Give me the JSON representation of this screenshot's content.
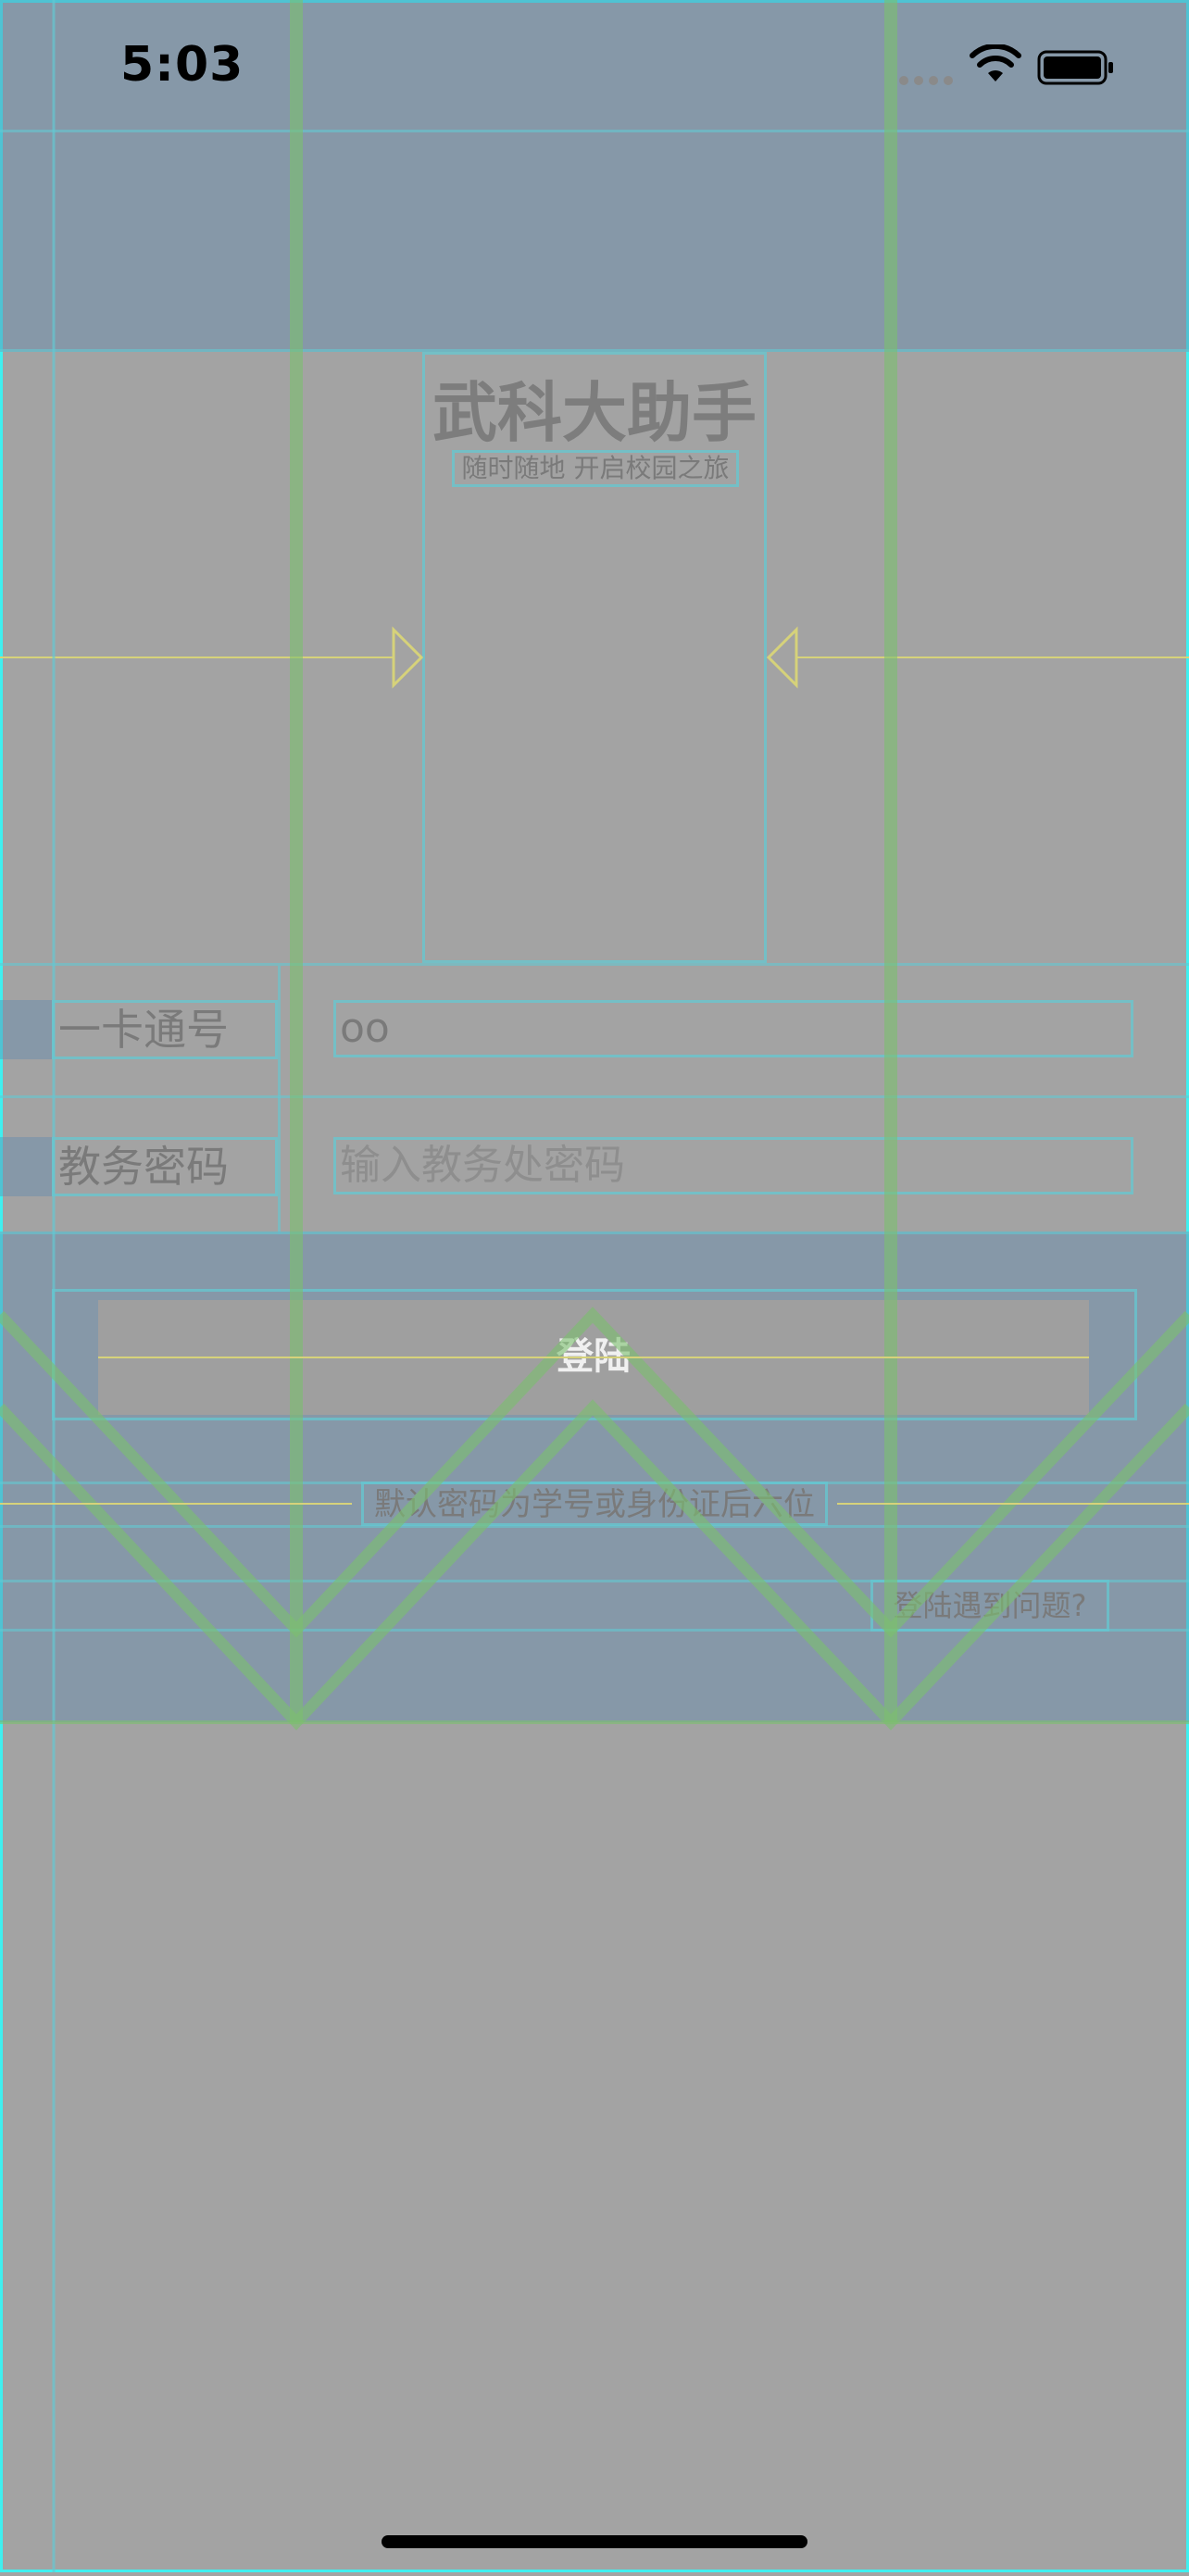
{
  "status_bar": {
    "time": "5:03",
    "signal_icon": "signal-dots-icon",
    "wifi_icon": "wifi-icon",
    "battery_icon": "battery-icon"
  },
  "header": {
    "title": "武科大助手",
    "subtitle": "随时随地 开启校园之旅"
  },
  "form": {
    "card_label": "一卡通号",
    "card_value": "oo",
    "password_label": "教务密码",
    "password_placeholder": "输入教务处密码"
  },
  "login": {
    "button_label": "登陆"
  },
  "hint": {
    "text": "默认密码为学号或身份证后六位"
  },
  "help": {
    "link_text": "登陆遇到问题?"
  },
  "colors": {
    "background": "#a3a3a3",
    "overlay_blue": "#6f8cb0",
    "guide_cyan": "#64c8d2",
    "guide_green": "#7cbf6e",
    "guide_yellow": "#d6d27a"
  }
}
